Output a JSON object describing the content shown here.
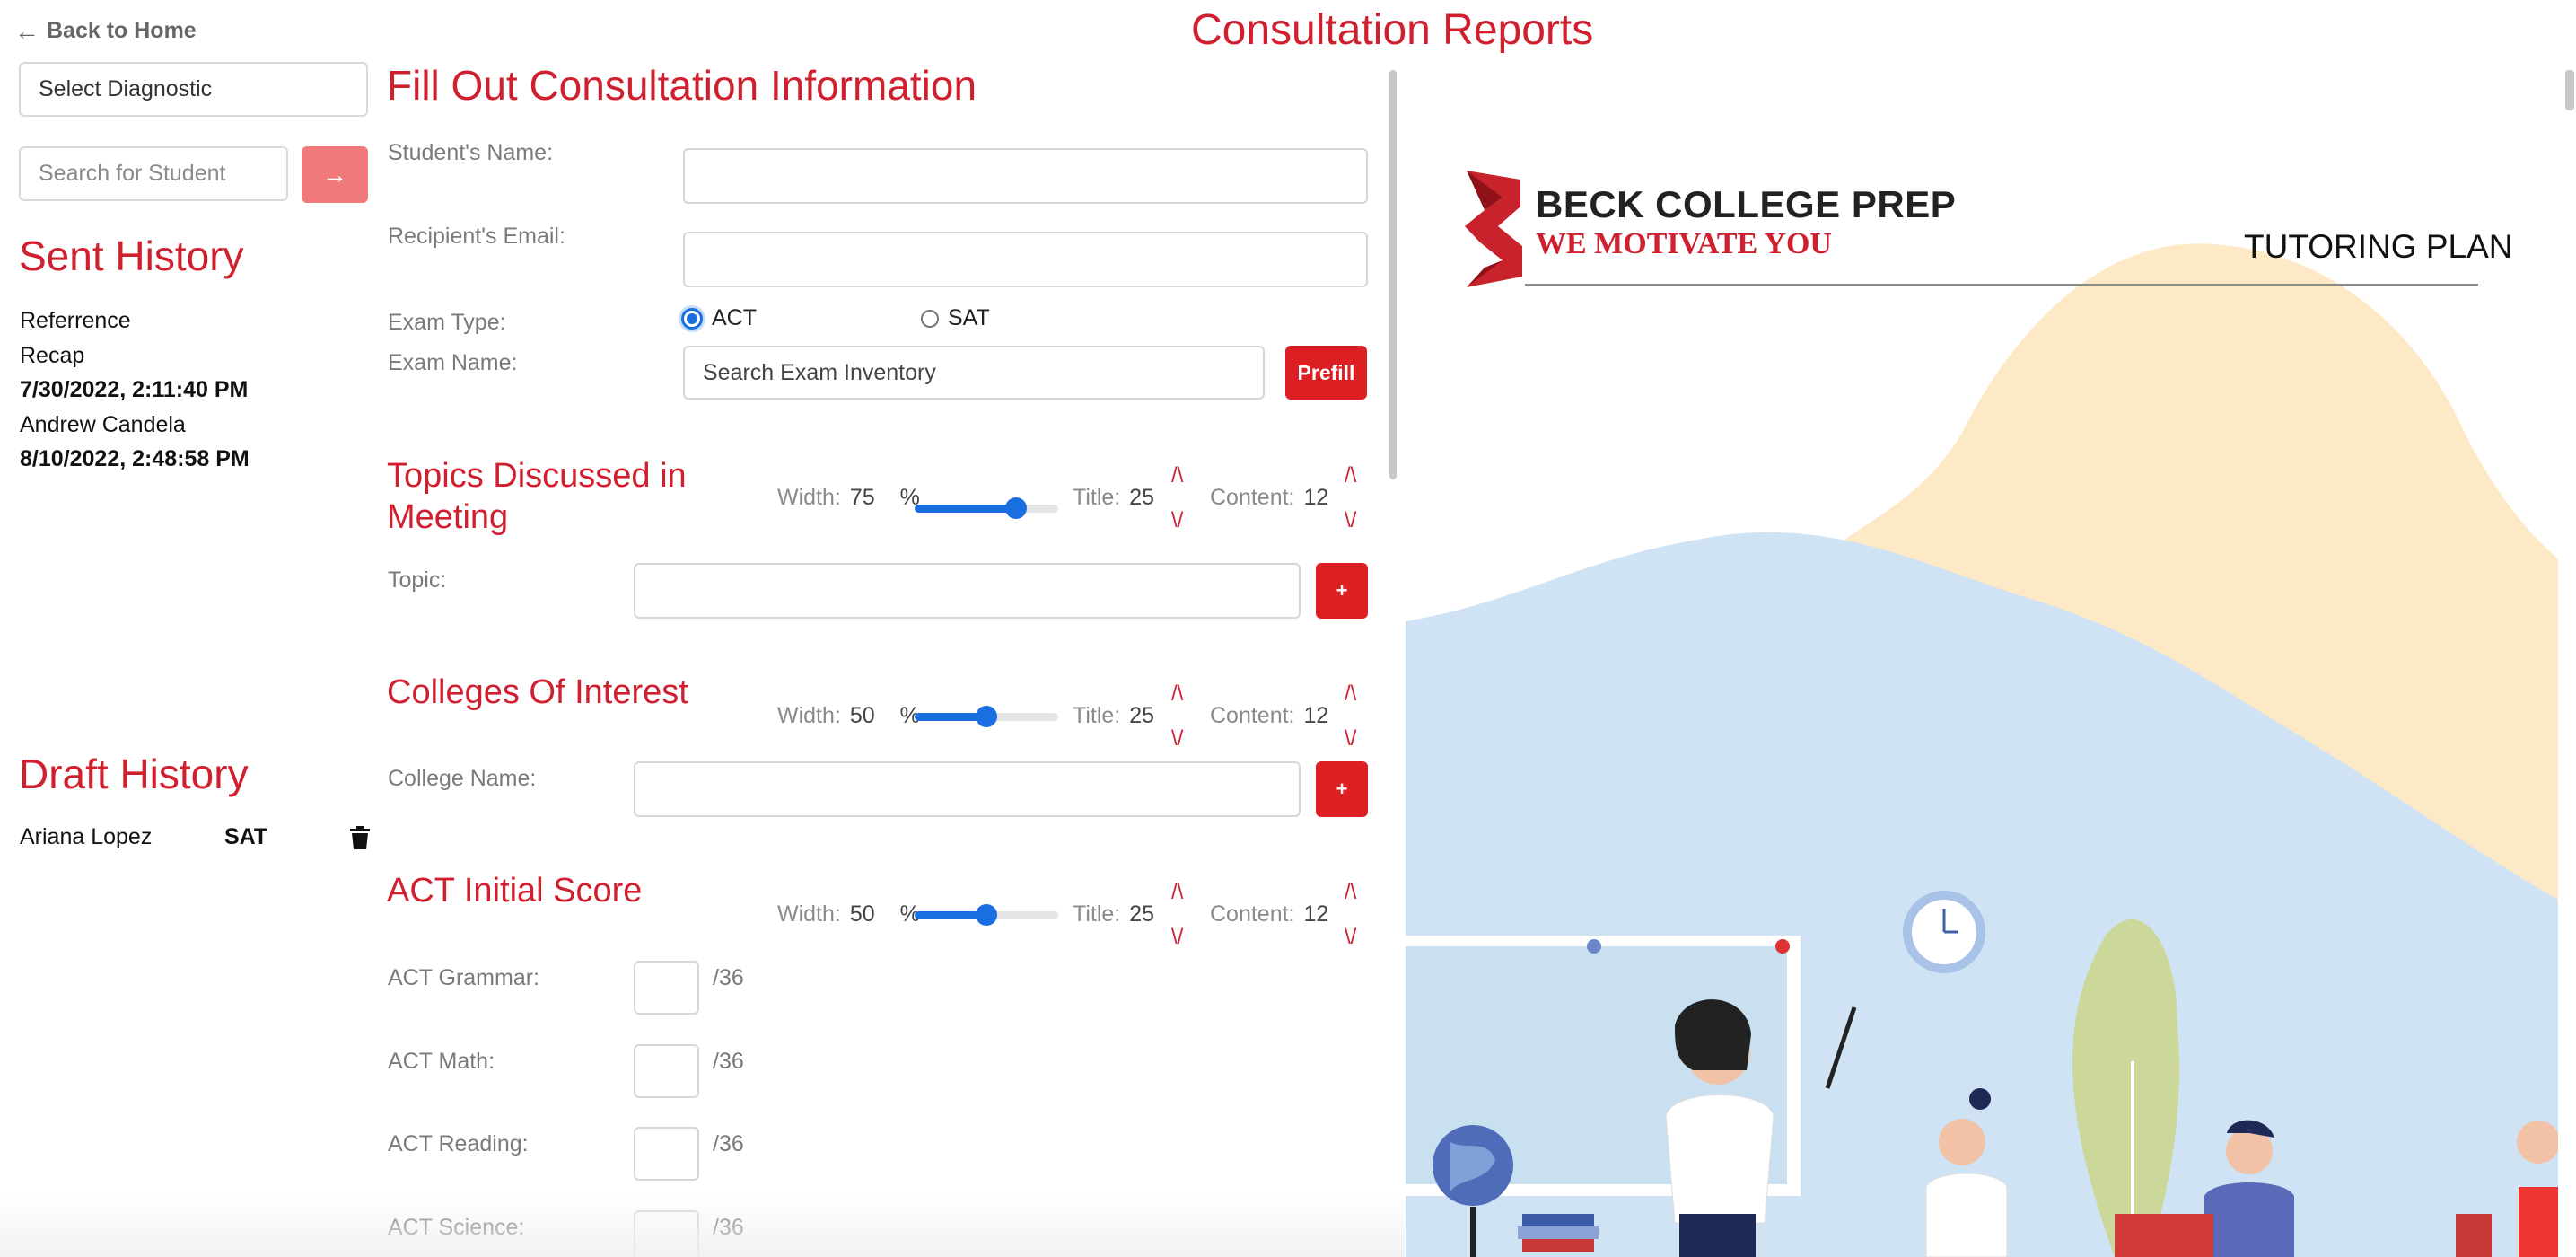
{
  "header": {
    "back_label": "Back to Home",
    "title": "Consultation Reports"
  },
  "sidebar": {
    "select_placeholder": "Select Diagnostic",
    "search_placeholder": "Search for Student",
    "search_button": "→",
    "sent_title": "Sent History",
    "sent_items": [
      {
        "text": "Referrence",
        "bold": false
      },
      {
        "text": "Recap",
        "bold": false
      },
      {
        "text": "7/30/2022, 2:11:40 PM",
        "bold": true
      },
      {
        "text": "Andrew Candela",
        "bold": false
      },
      {
        "text": "8/10/2022, 2:48:58 PM",
        "bold": true
      }
    ],
    "draft_title": "Draft History",
    "drafts": [
      {
        "name": "Ariana Lopez",
        "exam": "SAT"
      }
    ]
  },
  "form": {
    "title": "Fill Out Consultation Information",
    "student_name_label": "Student's Name:",
    "recipient_email_label": "Recipient's Email:",
    "exam_type_label": "Exam Type:",
    "exam_type_options": [
      "ACT",
      "SAT"
    ],
    "exam_type_selected": "ACT",
    "exam_name_label": "Exam Name:",
    "exam_search_placeholder": "Search Exam Inventory",
    "prefill_label": "Prefill",
    "ctrl_labels": {
      "width": "Width:",
      "percent": "%",
      "title": "Title:",
      "content": "Content:",
      "up": "/\\",
      "down": "\\/"
    },
    "sections": [
      {
        "title": "Topics Discussed in Meeting",
        "width": 75,
        "title_size": 25,
        "content_size": 12,
        "field_label": "Topic:",
        "add_label": "+"
      },
      {
        "title": "Colleges Of Interest",
        "width": 50,
        "title_size": 25,
        "content_size": 12,
        "field_label": "College Name:",
        "add_label": "+"
      },
      {
        "title": "ACT Initial Score",
        "width": 50,
        "title_size": 25,
        "content_size": 12
      }
    ],
    "scores": [
      {
        "label": "ACT Grammar:",
        "max": "/36"
      },
      {
        "label": "ACT Math:",
        "max": "/36"
      },
      {
        "label": "ACT Reading:",
        "max": "/36"
      },
      {
        "label": "ACT Science:",
        "max": "/36"
      }
    ]
  },
  "preview": {
    "brand_name": "BECK COLLEGE PREP",
    "tagline": "WE MOTIVATE YOU",
    "doc_title": "TUTORING PLAN"
  }
}
